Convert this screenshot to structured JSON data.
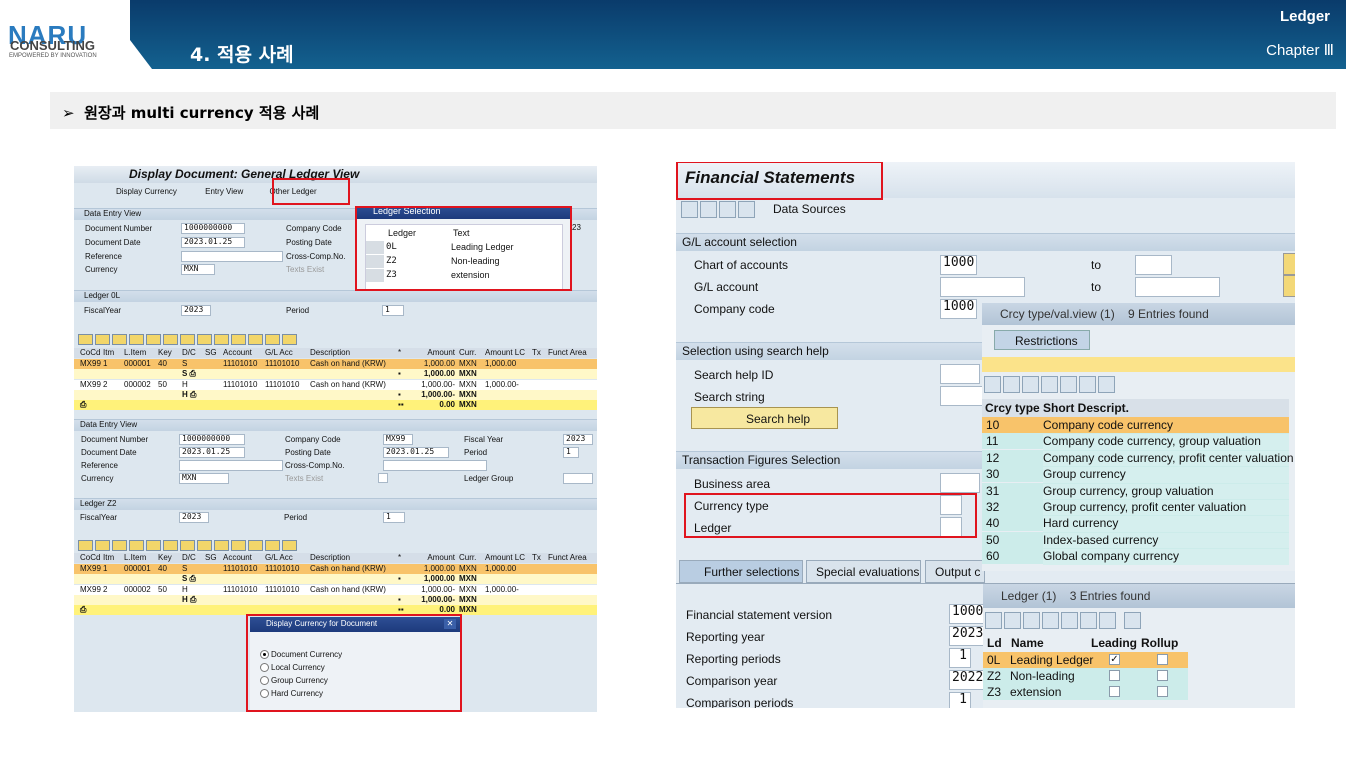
{
  "header": {
    "logo": "NARU",
    "logo_sub": "CONSULTING",
    "logo_tagline": "EMPOWERED BY INNOVATION",
    "section_title": "4. 적용 사례",
    "topic": "Ledger",
    "chapter": "Chapter Ⅲ"
  },
  "subtitle": {
    "bullet": "➢",
    "text": "원장과 multi currency 적용 사례"
  },
  "colors": {
    "header_blue": "#0d3f70",
    "highlight_red": "#e0141e",
    "row_orange": "#f8c36a",
    "row_yellow": "#fff27a"
  },
  "left": {
    "title": "Display Document: General Ledger View",
    "toolbar": {
      "display_currency": "Display Currency",
      "entry_view": "Entry View",
      "other_ledger": "Other Ledger"
    },
    "entry1": {
      "section": "Data Entry View",
      "labels": [
        "Document Number",
        "Document Date",
        "Reference",
        "Currency"
      ],
      "values": [
        "1000000000",
        "2023.01.25",
        "",
        "MXN"
      ],
      "labels2": [
        "Company Code",
        "Posting Date",
        "Cross-Comp.No.",
        "Texts Exist"
      ],
      "partial_value": "23"
    },
    "ledger_popup": {
      "title": "Ledger Selection",
      "col_ledger": "Ledger",
      "col_text": "Text",
      "rows": [
        [
          "0L",
          "Leading Ledger"
        ],
        [
          "Z2",
          "Non-leading"
        ],
        [
          "Z3",
          "extension"
        ]
      ]
    },
    "ledger1": {
      "section": "Ledger 0L",
      "fy_label": "FiscalYear",
      "fy": "2023",
      "period_label": "Period",
      "period": "1"
    },
    "columns": [
      "CoCd",
      "Itm",
      "L.Item",
      "Key",
      "D/C",
      "SG",
      "Account",
      "G/L Acc",
      "Description",
      "*",
      "Amount",
      "Curr.",
      "Amount LC",
      "Tx",
      "Funct Area"
    ],
    "rows": [
      [
        "MX99",
        "1",
        "000001",
        "40",
        "S",
        "",
        "11101010",
        "11101010",
        "Cash on hand (KRW)",
        "",
        "1,000.00",
        "MXN",
        "1,000.00",
        "",
        ""
      ],
      [
        "",
        "",
        "",
        "",
        "S ⎙",
        "",
        "",
        "",
        "",
        "▪",
        "1,000.00",
        "MXN",
        "",
        "",
        ""
      ],
      [
        "MX99",
        "2",
        "000002",
        "50",
        "H",
        "",
        "11101010",
        "11101010",
        "Cash on hand (KRW)",
        "",
        "1,000.00-",
        "MXN",
        "1,000.00-",
        "",
        ""
      ],
      [
        "",
        "",
        "",
        "",
        "H ⎙",
        "",
        "",
        "",
        "",
        "▪",
        "1,000.00-",
        "MXN",
        "",
        "",
        ""
      ],
      [
        "⎙",
        "",
        "",
        "",
        "",
        "",
        "",
        "",
        "",
        "▪▪",
        "0.00",
        "MXN",
        "",
        "",
        ""
      ]
    ],
    "entry2": {
      "section": "Data Entry View",
      "labels": [
        "Document Number",
        "Document Date",
        "Reference",
        "Currency"
      ],
      "values": [
        "1000000000",
        "2023.01.25",
        "",
        "MXN"
      ],
      "labels2": [
        "Company Code",
        "Posting Date",
        "Cross-Comp.No.",
        "Texts Exist"
      ],
      "values2": [
        "MX99",
        "2023.01.25",
        "",
        ""
      ],
      "labels3": [
        "Fiscal Year",
        "Period",
        "",
        "Ledger Group"
      ],
      "values3": [
        "2023",
        "1",
        "",
        ""
      ]
    },
    "ledger2": {
      "section": "Ledger Z2",
      "fy_label": "FiscalYear",
      "fy": "2023",
      "period_label": "Period",
      "period": "1"
    },
    "currency_dialog": {
      "title": "Display Currency for Document",
      "options": [
        "Document Currency",
        "Local Currency",
        "Group Currency",
        "Hard Currency"
      ],
      "selected": 0
    }
  },
  "right": {
    "title": "Financial Statements",
    "toolbar": {
      "data_sources": "Data Sources"
    },
    "gl": {
      "section": "G/L account selection",
      "rows": [
        {
          "label": "Chart of accounts",
          "value": "1000",
          "to": "to"
        },
        {
          "label": "G/L account",
          "value": "",
          "to": "to"
        },
        {
          "label": "Company code",
          "value": "1000",
          "to": ""
        }
      ]
    },
    "search": {
      "section": "Selection using search help",
      "id_label": "Search help ID",
      "string_label": "Search string",
      "button": "Search help"
    },
    "tx": {
      "section": "Transaction Figures Selection",
      "rows": [
        "Business area",
        "Currency type",
        "Ledger"
      ]
    },
    "tabs": [
      "Further selections",
      "Special evaluations",
      "Output c"
    ],
    "further": [
      {
        "label": "Financial statement version",
        "value": "1000"
      },
      {
        "label": "Reporting year",
        "value": "2023"
      },
      {
        "label": "Reporting periods",
        "value": "1"
      },
      {
        "label": "Comparison year",
        "value": "2022"
      },
      {
        "label": "Comparison periods",
        "value": "1"
      }
    ],
    "crcy_popup": {
      "title": "Crcy type/val.view (1)",
      "count": "9 Entries found",
      "tab": "Restrictions",
      "col1": "Crcy type",
      "col2": "Short Descript.",
      "rows": [
        [
          "10",
          "Company code currency"
        ],
        [
          "11",
          "Company code currency, group valuation"
        ],
        [
          "12",
          "Company code currency, profit center valuation"
        ],
        [
          "30",
          "Group currency"
        ],
        [
          "31",
          "Group currency, group valuation"
        ],
        [
          "32",
          "Group currency, profit center valuation"
        ],
        [
          "40",
          "Hard currency"
        ],
        [
          "50",
          "Index-based currency"
        ],
        [
          "60",
          "Global company currency"
        ]
      ]
    },
    "ledger_popup": {
      "title": "Ledger (1)",
      "count": "3 Entries found",
      "cols": [
        "Ld",
        "Name",
        "Leading",
        "Rollup"
      ],
      "rows": [
        {
          "ld": "0L",
          "name": "Leading Ledger",
          "leading": true,
          "rollup": false
        },
        {
          "ld": "Z2",
          "name": "Non-leading",
          "leading": false,
          "rollup": false
        },
        {
          "ld": "Z3",
          "name": "extension",
          "leading": false,
          "rollup": false
        }
      ]
    }
  }
}
